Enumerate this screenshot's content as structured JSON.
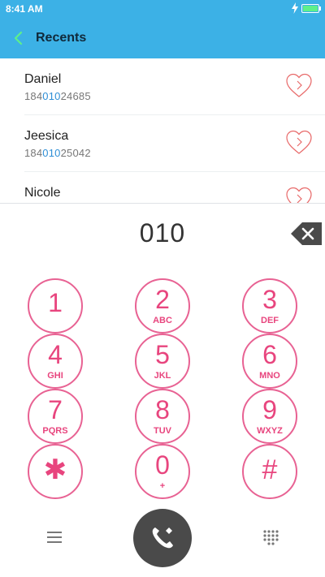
{
  "status": {
    "time": "8:41 AM"
  },
  "header": {
    "title": "Recents"
  },
  "contacts": [
    {
      "name": "Daniel",
      "num_prefix": "184",
      "num_match": "010",
      "num_suffix": "24685"
    },
    {
      "name": "Jeesica",
      "num_prefix": "184",
      "num_match": "010",
      "num_suffix": "25042"
    },
    {
      "name": "Nicole",
      "num_prefix": "",
      "num_match": "",
      "num_suffix": ""
    }
  ],
  "dialer": {
    "input": "010",
    "keys": [
      {
        "digit": "1",
        "letters": ""
      },
      {
        "digit": "2",
        "letters": "ABC"
      },
      {
        "digit": "3",
        "letters": "DEF"
      },
      {
        "digit": "4",
        "letters": "GHI"
      },
      {
        "digit": "5",
        "letters": "JKL"
      },
      {
        "digit": "6",
        "letters": "MNO"
      },
      {
        "digit": "7",
        "letters": "PQRS"
      },
      {
        "digit": "8",
        "letters": "TUV"
      },
      {
        "digit": "9",
        "letters": "WXYZ"
      },
      {
        "digit": "✱",
        "letters": ""
      },
      {
        "digit": "0",
        "letters": "+"
      },
      {
        "digit": "#",
        "letters": ""
      }
    ]
  },
  "colors": {
    "header_bg": "#3cb1e6",
    "accent": "#e8457e",
    "match": "#2f8fd6",
    "call_bg": "#4a4a4a"
  }
}
